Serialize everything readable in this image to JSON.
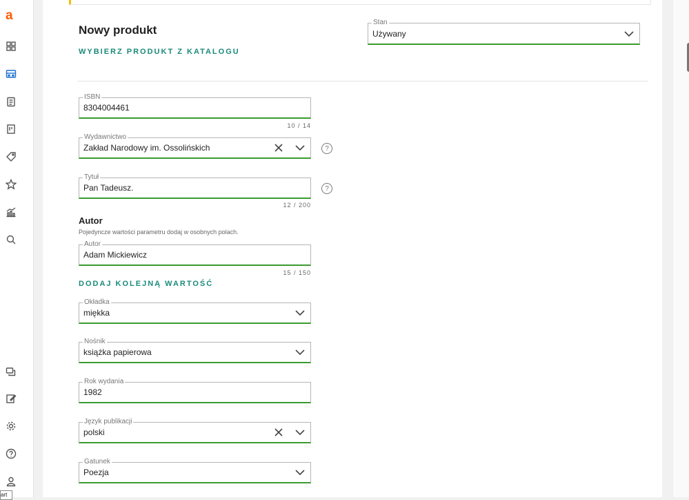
{
  "rail": {
    "logo": "a",
    "icons": [
      "dashboard-icon",
      "storefront-icon",
      "clipboard-icon",
      "receipt-icon",
      "tag-icon",
      "star-icon",
      "analytics-icon",
      "search-icon"
    ],
    "bottom_icons": [
      "chat-icon",
      "edit-icon",
      "gear-icon",
      "help-icon",
      "user-icon"
    ],
    "bottom_tag": "art"
  },
  "form": {
    "title": "Nowy produkt",
    "catalog_link": "WYBIERZ PRODUKT Z KATALOGU",
    "stan": {
      "label": "Stan",
      "value": "Używany"
    },
    "isbn": {
      "label": "ISBN",
      "value": "8304004461",
      "counter": "10 / 14"
    },
    "wydawnictwo": {
      "label": "Wydawnictwo",
      "value": "Zakład Narodowy im. Ossolińskich"
    },
    "tytul": {
      "label": "Tytuł",
      "value": "Pan Tadeusz.",
      "counter": "12 / 200"
    },
    "autor_section": {
      "heading": "Autor",
      "hint": "Pojedyncze wartości parametru dodaj w osobnych polach.",
      "label": "Autor",
      "value": "Adam Mickiewicz",
      "counter": "15 / 150",
      "add_link": "DODAJ KOLEJNĄ WARTOŚĆ"
    },
    "okladka": {
      "label": "Okładka",
      "value": "miękka"
    },
    "nosnik": {
      "label": "Nośnik",
      "value": "książka papierowa"
    },
    "rok": {
      "label": "Rok wydania",
      "value": "1982"
    },
    "jezyk": {
      "label": "Język publikacji",
      "value": "polski"
    },
    "gatunek": {
      "label": "Gatunek",
      "value": "Poezja"
    },
    "help_glyph": "?"
  },
  "colors": {
    "accent_green": "#3a9b2f",
    "link_teal": "#1a8a7a",
    "brand_orange": "#ff5a00",
    "highlight_yellow": "#f0c000"
  }
}
